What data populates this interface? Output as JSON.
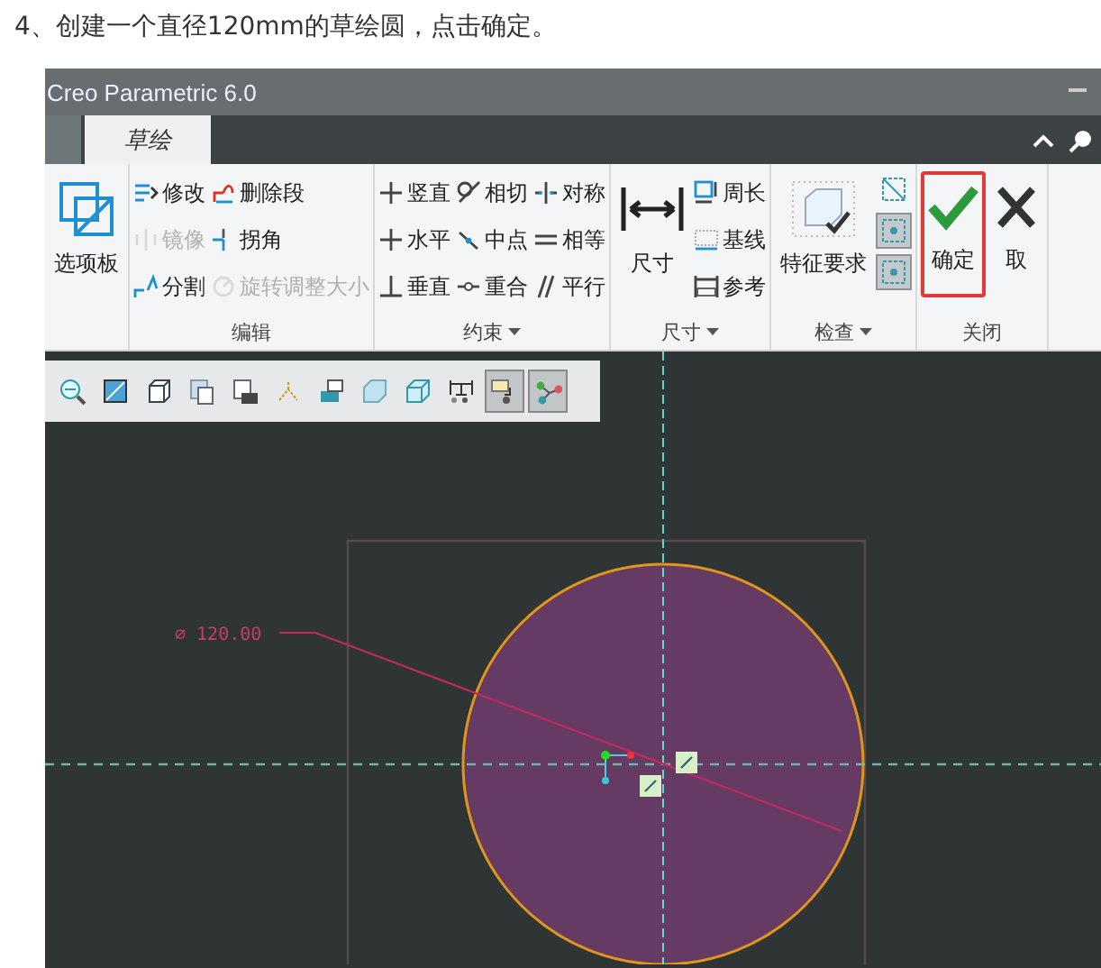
{
  "heading": "4、创建一个直径120mm的草绘圆，点击确定。",
  "window": {
    "title": "Creo Parametric 6.0"
  },
  "tabs": [
    {
      "selected": false
    },
    {
      "label": "草绘",
      "selected": true
    }
  ],
  "ribbon": [
    {
      "large": [
        {
          "label": "选项板",
          "highlighted": false
        }
      ]
    },
    {
      "label": "编辑",
      "menu": false,
      "rows": [
        [
          {
            "label": "修改",
            "disabled": false
          },
          {
            "label": "删除段",
            "disabled": false
          }
        ],
        [
          {
            "label": "镜像",
            "disabled": true
          },
          {
            "label": "拐角",
            "disabled": false
          }
        ],
        [
          {
            "label": "分割",
            "disabled": false
          },
          {
            "label": "旋转调整大小",
            "disabled": true
          }
        ]
      ]
    },
    {
      "label": "约束",
      "menu": true,
      "rows": [
        [
          {
            "label": "竖直",
            "disabled": false
          },
          {
            "label": "相切",
            "disabled": false
          },
          {
            "label": "对称",
            "disabled": false
          }
        ],
        [
          {
            "label": "水平",
            "disabled": false
          },
          {
            "label": "中点",
            "disabled": false
          },
          {
            "label": "相等",
            "disabled": false
          }
        ],
        [
          {
            "label": "垂直",
            "disabled": false
          },
          {
            "label": "重合",
            "disabled": false
          },
          {
            "label": "平行",
            "disabled": false
          }
        ]
      ]
    },
    {
      "label": "尺寸",
      "menu": true,
      "large": [
        {
          "label": "尺寸",
          "highlighted": false
        }
      ],
      "rows": [
        [
          {
            "label": "周长",
            "disabled": false
          }
        ],
        [
          {
            "label": "基线",
            "disabled": false
          }
        ],
        [
          {
            "label": "参考",
            "disabled": false
          }
        ]
      ]
    },
    {
      "label": "检查",
      "menu": true,
      "large": [
        {
          "label": "特征要求",
          "highlighted": false
        }
      ],
      "toggles": [
        {
          "on": false
        },
        {
          "on": true
        },
        {
          "on": true
        }
      ]
    },
    {
      "label": "关闭",
      "menu": false,
      "large": [
        {
          "label": "确定",
          "highlighted": true
        },
        {
          "label": "取",
          "highlighted": false
        }
      ]
    }
  ],
  "view_toolbar": [
    {
      "on": false
    },
    {
      "on": false
    },
    {
      "on": false
    },
    {
      "on": false
    },
    {
      "on": false
    },
    {
      "on": false
    },
    {
      "on": false
    },
    {
      "on": false
    },
    {
      "on": false
    },
    {
      "on": false
    },
    {
      "on": true
    },
    {
      "on": true
    }
  ],
  "sketch": {
    "dimension": "⌀ 120.00"
  }
}
